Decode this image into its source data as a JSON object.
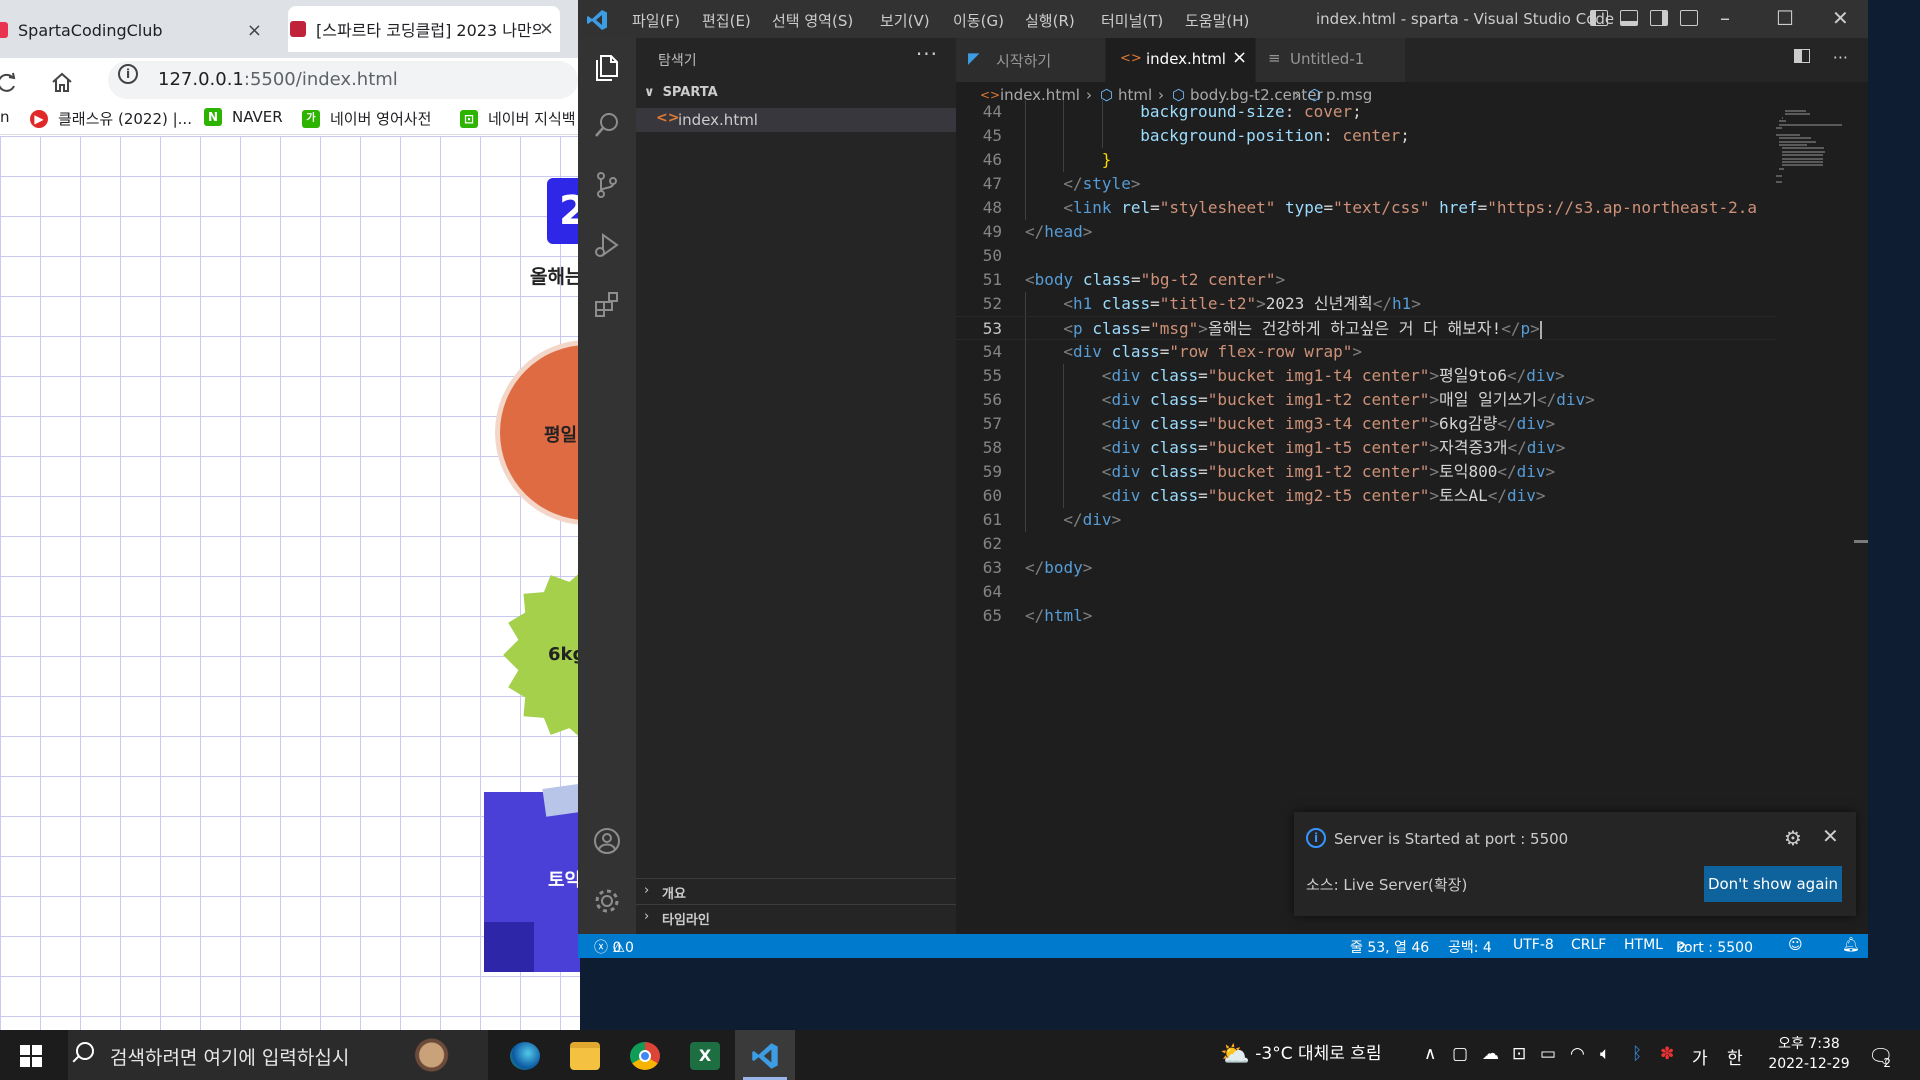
{
  "browser": {
    "tabs": [
      {
        "label": "SpartaCodingClub",
        "close": "×"
      },
      {
        "label": "[스파르타 코딩클럽] 2023 나만의",
        "close": "×"
      }
    ],
    "address_host": "127.0.0.1",
    "address_path": ":5500/index.html",
    "bookmarks": [
      {
        "label": "n",
        "icon": "bookmark-icon"
      },
      {
        "label": "클래스유 (2022) |...",
        "icon": "classu-icon"
      },
      {
        "label": "NAVER",
        "icon": "naver-icon",
        "badge": "N"
      },
      {
        "label": "네이버 영어사전",
        "icon": "naver-dict-icon",
        "badge": "가"
      },
      {
        "label": "네이버 지식백",
        "icon": "naver-kin-icon",
        "badge": "⊡"
      }
    ],
    "page": {
      "year_fragment": "2",
      "msg_fragment": "올해는",
      "bucket_1": "평일",
      "bucket_2": "6kg",
      "bucket_3": "토익"
    }
  },
  "vscode": {
    "menu": [
      "파일(F)",
      "편집(E)",
      "선택 영역(S)",
      "보기(V)",
      "이동(G)",
      "실행(R)",
      "터미널(T)",
      "도움말(H)"
    ],
    "window_title": "index.html - sparta - Visual Studio Code",
    "explorer": {
      "title": "탐색기",
      "more": "···",
      "folder": "SPARTA",
      "files": [
        "index.html"
      ],
      "sections": [
        "개요",
        "타임라인"
      ]
    },
    "tabs": [
      {
        "label": "시작하기",
        "icon": "vscode-icon"
      },
      {
        "label": "index.html",
        "icon": "html-icon",
        "close": "×"
      },
      {
        "label": "Untitled-1",
        "icon": "file-lines-icon"
      }
    ],
    "breadcrumb": [
      "index.html",
      "html",
      "body.bg-t2.center",
      "p.msg"
    ],
    "current_line": 53,
    "code_lines": [
      {
        "n": 44,
        "indent": 3,
        "parts": [
          [
            "at",
            "background-size"
          ],
          [
            "tx2",
            ": "
          ],
          [
            "av",
            "cover"
          ],
          [
            "tx2",
            ";"
          ]
        ]
      },
      {
        "n": 45,
        "indent": 3,
        "parts": [
          [
            "at",
            "background-position"
          ],
          [
            "tx2",
            ": "
          ],
          [
            "av",
            "center"
          ],
          [
            "tx2",
            ";"
          ]
        ]
      },
      {
        "n": 46,
        "indent": 2,
        "parts": [
          [
            "br",
            "}"
          ]
        ]
      },
      {
        "n": 47,
        "indent": 1,
        "parts": [
          [
            "t",
            "</"
          ],
          [
            "tn",
            "style"
          ],
          [
            "t",
            ">"
          ]
        ]
      },
      {
        "n": 48,
        "indent": 1,
        "parts": [
          [
            "t",
            "<"
          ],
          [
            "tn",
            "link"
          ],
          [
            "tx2",
            " "
          ],
          [
            "at",
            "rel"
          ],
          [
            "tx2",
            "="
          ],
          [
            "av",
            "\"stylesheet\""
          ],
          [
            "tx2",
            " "
          ],
          [
            "at",
            "type"
          ],
          [
            "tx2",
            "="
          ],
          [
            "av",
            "\"text/css\""
          ],
          [
            "tx2",
            " "
          ],
          [
            "at",
            "href"
          ],
          [
            "tx2",
            "="
          ],
          [
            "av",
            "\"https://s3.ap-northeast-2.a"
          ]
        ]
      },
      {
        "n": 49,
        "indent": 0,
        "parts": [
          [
            "t",
            "</"
          ],
          [
            "tn",
            "head"
          ],
          [
            "t",
            ">"
          ]
        ]
      },
      {
        "n": 50,
        "indent": 0,
        "parts": []
      },
      {
        "n": 51,
        "indent": 0,
        "parts": [
          [
            "t",
            "<"
          ],
          [
            "tn",
            "body"
          ],
          [
            "tx2",
            " "
          ],
          [
            "at",
            "class"
          ],
          [
            "tx2",
            "="
          ],
          [
            "av",
            "\"bg-t2 center\""
          ],
          [
            "t",
            ">"
          ]
        ]
      },
      {
        "n": 52,
        "indent": 1,
        "parts": [
          [
            "t",
            "<"
          ],
          [
            "tn",
            "h1"
          ],
          [
            "tx2",
            " "
          ],
          [
            "at",
            "class"
          ],
          [
            "tx2",
            "="
          ],
          [
            "av",
            "\"title-t2\""
          ],
          [
            "t",
            ">"
          ],
          [
            "tx2",
            "2023 신년계획"
          ],
          [
            "t",
            "</"
          ],
          [
            "tn",
            "h1"
          ],
          [
            "t",
            ">"
          ]
        ]
      },
      {
        "n": 53,
        "indent": 1,
        "parts": [
          [
            "t",
            "<"
          ],
          [
            "tn",
            "p"
          ],
          [
            "tx2",
            " "
          ],
          [
            "at",
            "class"
          ],
          [
            "tx2",
            "="
          ],
          [
            "av",
            "\"msg\""
          ],
          [
            "t",
            ">"
          ],
          [
            "tx2",
            "올해는 건강하게 하고싶은 거 다 해보자!"
          ],
          [
            "t",
            "</"
          ],
          [
            "tn",
            "p"
          ],
          [
            "t",
            ">"
          ]
        ]
      },
      {
        "n": 54,
        "indent": 1,
        "parts": [
          [
            "t",
            "<"
          ],
          [
            "tn",
            "div"
          ],
          [
            "tx2",
            " "
          ],
          [
            "at",
            "class"
          ],
          [
            "tx2",
            "="
          ],
          [
            "av",
            "\"row flex-row wrap\""
          ],
          [
            "t",
            ">"
          ]
        ]
      },
      {
        "n": 55,
        "indent": 2,
        "parts": [
          [
            "t",
            "<"
          ],
          [
            "tn",
            "div"
          ],
          [
            "tx2",
            " "
          ],
          [
            "at",
            "class"
          ],
          [
            "tx2",
            "="
          ],
          [
            "av",
            "\"bucket img1-t4 center\""
          ],
          [
            "t",
            ">"
          ],
          [
            "tx2",
            "평일9to6"
          ],
          [
            "t",
            "</"
          ],
          [
            "tn",
            "div"
          ],
          [
            "t",
            ">"
          ]
        ]
      },
      {
        "n": 56,
        "indent": 2,
        "parts": [
          [
            "t",
            "<"
          ],
          [
            "tn",
            "div"
          ],
          [
            "tx2",
            " "
          ],
          [
            "at",
            "class"
          ],
          [
            "tx2",
            "="
          ],
          [
            "av",
            "\"bucket img1-t2 center\""
          ],
          [
            "t",
            ">"
          ],
          [
            "tx2",
            "매일 일기쓰기"
          ],
          [
            "t",
            "</"
          ],
          [
            "tn",
            "div"
          ],
          [
            "t",
            ">"
          ]
        ]
      },
      {
        "n": 57,
        "indent": 2,
        "parts": [
          [
            "t",
            "<"
          ],
          [
            "tn",
            "div"
          ],
          [
            "tx2",
            " "
          ],
          [
            "at",
            "class"
          ],
          [
            "tx2",
            "="
          ],
          [
            "av",
            "\"bucket img3-t4 center\""
          ],
          [
            "t",
            ">"
          ],
          [
            "tx2",
            "6kg감량"
          ],
          [
            "t",
            "</"
          ],
          [
            "tn",
            "div"
          ],
          [
            "t",
            ">"
          ]
        ]
      },
      {
        "n": 58,
        "indent": 2,
        "parts": [
          [
            "t",
            "<"
          ],
          [
            "tn",
            "div"
          ],
          [
            "tx2",
            " "
          ],
          [
            "at",
            "class"
          ],
          [
            "tx2",
            "="
          ],
          [
            "av",
            "\"bucket img1-t5 center\""
          ],
          [
            "t",
            ">"
          ],
          [
            "tx2",
            "자격증3개"
          ],
          [
            "t",
            "</"
          ],
          [
            "tn",
            "div"
          ],
          [
            "t",
            ">"
          ]
        ]
      },
      {
        "n": 59,
        "indent": 2,
        "parts": [
          [
            "t",
            "<"
          ],
          [
            "tn",
            "div"
          ],
          [
            "tx2",
            " "
          ],
          [
            "at",
            "class"
          ],
          [
            "tx2",
            "="
          ],
          [
            "av",
            "\"bucket img1-t2 center\""
          ],
          [
            "t",
            ">"
          ],
          [
            "tx2",
            "토익800"
          ],
          [
            "t",
            "</"
          ],
          [
            "tn",
            "div"
          ],
          [
            "t",
            ">"
          ]
        ]
      },
      {
        "n": 60,
        "indent": 2,
        "parts": [
          [
            "t",
            "<"
          ],
          [
            "tn",
            "div"
          ],
          [
            "tx2",
            " "
          ],
          [
            "at",
            "class"
          ],
          [
            "tx2",
            "="
          ],
          [
            "av",
            "\"bucket img2-t5 center\""
          ],
          [
            "t",
            ">"
          ],
          [
            "tx2",
            "토스AL"
          ],
          [
            "t",
            "</"
          ],
          [
            "tn",
            "div"
          ],
          [
            "t",
            ">"
          ]
        ]
      },
      {
        "n": 61,
        "indent": 1,
        "parts": [
          [
            "t",
            "</"
          ],
          [
            "tn",
            "div"
          ],
          [
            "t",
            ">"
          ]
        ]
      },
      {
        "n": 62,
        "indent": 0,
        "parts": []
      },
      {
        "n": 63,
        "indent": 0,
        "parts": [
          [
            "t",
            "</"
          ],
          [
            "tn",
            "body"
          ],
          [
            "t",
            ">"
          ]
        ]
      },
      {
        "n": 64,
        "indent": 0,
        "parts": []
      },
      {
        "n": 65,
        "indent": 0,
        "parts": [
          [
            "t",
            "</"
          ],
          [
            "tn",
            "html"
          ],
          [
            "t",
            ">"
          ]
        ]
      }
    ],
    "notification": {
      "message": "Server is Started at port : 5500",
      "source": "소스: Live Server(확장)",
      "button": "Don't show again"
    },
    "status": {
      "errors": "0",
      "warnings": "0",
      "position": "줄 53, 열 46",
      "spaces": "공백: 4",
      "encoding": "UTF-8",
      "eol": "CRLF",
      "language": "HTML",
      "port": "Port : 5500"
    },
    "colors": {
      "tag": "#569cd6",
      "attr": "#9cdcfe",
      "value": "#ce9178",
      "status": "#007acc"
    }
  },
  "taskbar": {
    "search_placeholder": "검색하려면 여기에 입력하십시",
    "apps": [
      "edge-icon",
      "file-explorer-icon",
      "chrome-icon",
      "excel-icon",
      "vscode-icon"
    ],
    "weather": "-3°C 대체로 흐림",
    "ime": "가",
    "lang": "한",
    "time": "오후 7:38",
    "date": "2022-12-29",
    "notifications": "2"
  }
}
